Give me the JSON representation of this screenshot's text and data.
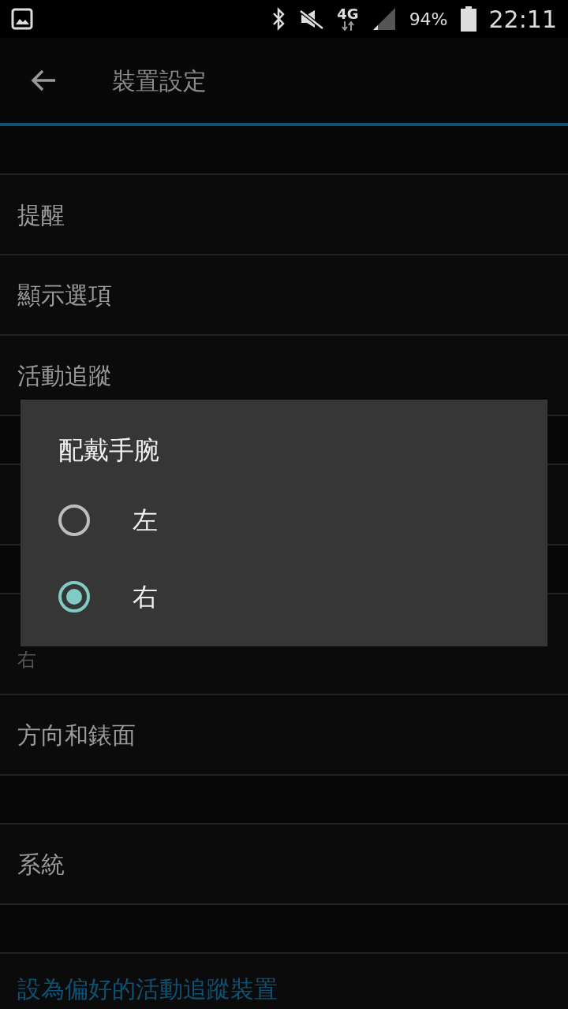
{
  "status_bar": {
    "network": "4G",
    "battery": "94%",
    "time": "22:11"
  },
  "app_bar": {
    "title": "裝置設定"
  },
  "settings": [
    {
      "kind": "spacer"
    },
    {
      "kind": "item",
      "title": "提醒"
    },
    {
      "kind": "item",
      "title": "顯示選項"
    },
    {
      "kind": "item",
      "title": "活動追蹤"
    },
    {
      "kind": "spacer"
    },
    {
      "kind": "item"
    },
    {
      "kind": "spacer"
    },
    {
      "kind": "item",
      "subtitle": "右"
    },
    {
      "kind": "item",
      "title": "方向和錶面"
    },
    {
      "kind": "spacer"
    },
    {
      "kind": "item",
      "title": "系統"
    },
    {
      "kind": "spacer"
    },
    {
      "kind": "link",
      "title": "設為偏好的活動追蹤裝置"
    }
  ],
  "dialog": {
    "title": "配戴手腕",
    "options": [
      {
        "label": "左",
        "selected": false
      },
      {
        "label": "右",
        "selected": true
      }
    ]
  }
}
